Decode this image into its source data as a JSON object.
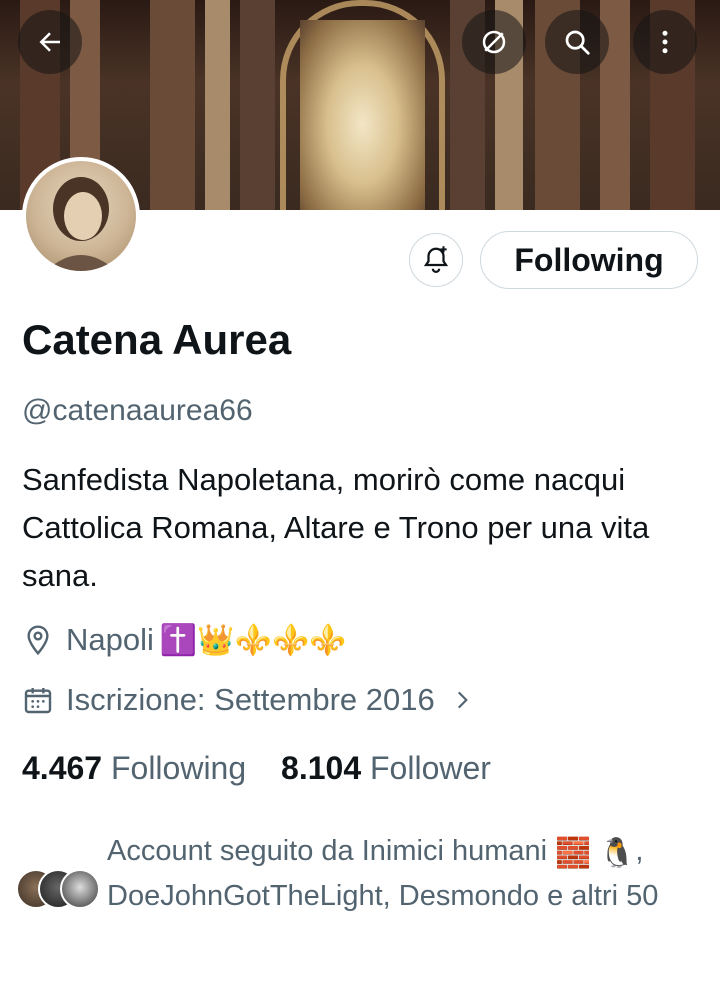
{
  "header": {
    "back_icon": "arrow-left-icon",
    "grok_icon": "no-symbol-icon",
    "search_icon": "search-icon",
    "more_icon": "more-vertical-icon"
  },
  "actions": {
    "notify_icon": "bell-plus-icon",
    "following_label": "Following"
  },
  "profile": {
    "name": "Catena Aurea",
    "handle": "@catenaaurea66",
    "bio": "Sanfedista Napoletana, morirò come nacqui Cattolica Romana, Altare e Trono per una vita sana.",
    "location": "Napoli",
    "location_emojis": "✝️👑⚜️⚜️⚜️",
    "joined": "Iscrizione: Settembre 2016"
  },
  "stats": {
    "following_count": "4.467",
    "following_label": "Following",
    "followers_count": "8.104",
    "followers_label": "Follower"
  },
  "followed_by": {
    "text_prefix": "Account seguito da Inimici humani",
    "emoji1": "🧱",
    "emoji2": "🐧",
    "text_suffix": ", DoeJohnGotTheLight, Desmondo e altri 50"
  },
  "colors": {
    "text_primary": "#0f1419",
    "text_secondary": "#536471",
    "border": "#cfd9de"
  }
}
